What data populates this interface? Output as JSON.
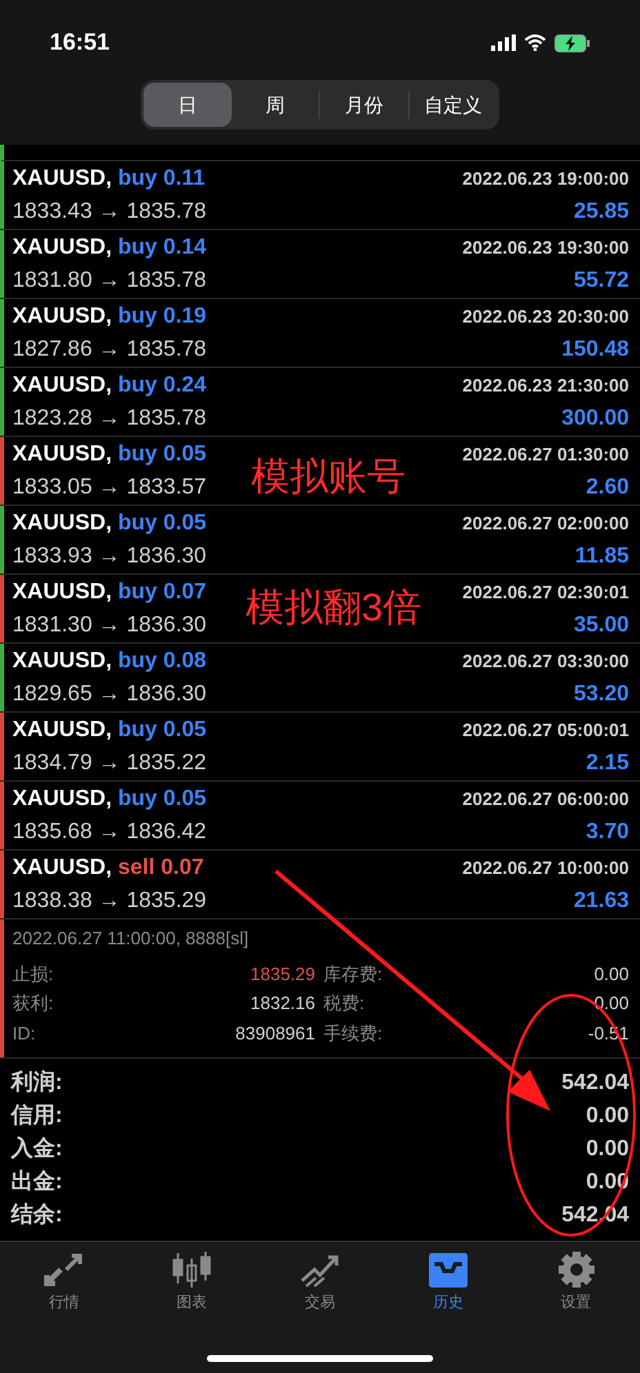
{
  "status_bar": {
    "time": "16:51"
  },
  "period_tabs": [
    {
      "label": "日",
      "selected": true
    },
    {
      "label": "周",
      "selected": false
    },
    {
      "label": "月份",
      "selected": false
    },
    {
      "label": "自定义",
      "selected": false
    }
  ],
  "trades": [
    {
      "symbol": "XAUUSD,",
      "kind": "buy",
      "type_label": "buy 0.11",
      "time": "2022.06.23 19:00:00",
      "prices": "1833.43 → 1835.78",
      "profit": "25.85",
      "color": "#3fae3f"
    },
    {
      "symbol": "XAUUSD,",
      "kind": "buy",
      "type_label": "buy 0.14",
      "time": "2022.06.23 19:30:00",
      "prices": "1831.80 → 1835.78",
      "profit": "55.72",
      "color": "#3fae3f"
    },
    {
      "symbol": "XAUUSD,",
      "kind": "buy",
      "type_label": "buy 0.19",
      "time": "2022.06.23 20:30:00",
      "prices": "1827.86 → 1835.78",
      "profit": "150.48",
      "color": "#3fae3f"
    },
    {
      "symbol": "XAUUSD,",
      "kind": "buy",
      "type_label": "buy 0.24",
      "time": "2022.06.23 21:30:00",
      "prices": "1823.28 → 1835.78",
      "profit": "300.00",
      "color": "#3fae3f"
    },
    {
      "symbol": "XAUUSD,",
      "kind": "buy",
      "type_label": "buy 0.05",
      "time": "2022.06.27 01:30:00",
      "prices": "1833.05 → 1833.57",
      "profit": "2.60",
      "color": "#d9463e"
    },
    {
      "symbol": "XAUUSD,",
      "kind": "buy",
      "type_label": "buy 0.05",
      "time": "2022.06.27 02:00:00",
      "prices": "1833.93 → 1836.30",
      "profit": "11.85",
      "color": "#3fae3f"
    },
    {
      "symbol": "XAUUSD,",
      "kind": "buy",
      "type_label": "buy 0.07",
      "time": "2022.06.27 02:30:01",
      "prices": "1831.30 → 1836.30",
      "profit": "35.00",
      "color": "#d9463e"
    },
    {
      "symbol": "XAUUSD,",
      "kind": "buy",
      "type_label": "buy 0.08",
      "time": "2022.06.27 03:30:00",
      "prices": "1829.65 → 1836.30",
      "profit": "53.20",
      "color": "#3fae3f"
    },
    {
      "symbol": "XAUUSD,",
      "kind": "buy",
      "type_label": "buy 0.05",
      "time": "2022.06.27 05:00:01",
      "prices": "1834.79 → 1835.22",
      "profit": "2.15",
      "color": "#d9463e"
    },
    {
      "symbol": "XAUUSD,",
      "kind": "buy",
      "type_label": "buy 0.05",
      "time": "2022.06.27 06:00:00",
      "prices": "1835.68 → 1836.42",
      "profit": "3.70",
      "color": "#d9463e"
    },
    {
      "symbol": "XAUUSD,",
      "kind": "sell",
      "type_label": "sell 0.07",
      "time": "2022.06.27 10:00:00",
      "prices": "1838.38 → 1835.29",
      "profit": "21.63",
      "color": "#d9463e"
    }
  ],
  "trade_detail": {
    "close_info": "2022.06.27 11:00:00, 8888[sl]",
    "fields": [
      {
        "label": "止损:",
        "value": "1835.29",
        "kind": "loss"
      },
      {
        "label": "库存费:",
        "value": "0.00",
        "kind": "plain"
      },
      {
        "label": "获利:",
        "value": "1832.16",
        "kind": "plain"
      },
      {
        "label": "税费:",
        "value": "0.00",
        "kind": "plain"
      },
      {
        "label": "ID:",
        "value": "83908961",
        "kind": "plain"
      },
      {
        "label": "手续费:",
        "value": "-0.51",
        "kind": "plain"
      }
    ]
  },
  "summary": [
    {
      "label": "利润:",
      "value": "542.04"
    },
    {
      "label": "信用:",
      "value": "0.00"
    },
    {
      "label": "入金:",
      "value": "0.00"
    },
    {
      "label": "出金:",
      "value": "0.00"
    },
    {
      "label": "结余:",
      "value": "542.04"
    }
  ],
  "annotations": [
    {
      "text": "模拟账号"
    },
    {
      "text": "模拟翻3倍"
    }
  ],
  "bottom_tabs": [
    {
      "label": "行情",
      "kind": "quotes",
      "selected": false
    },
    {
      "label": "图表",
      "kind": "chart",
      "selected": false
    },
    {
      "label": "交易",
      "kind": "trade",
      "selected": false
    },
    {
      "label": "历史",
      "kind": "history",
      "selected": true
    },
    {
      "label": "设置",
      "kind": "settings",
      "selected": false
    }
  ]
}
